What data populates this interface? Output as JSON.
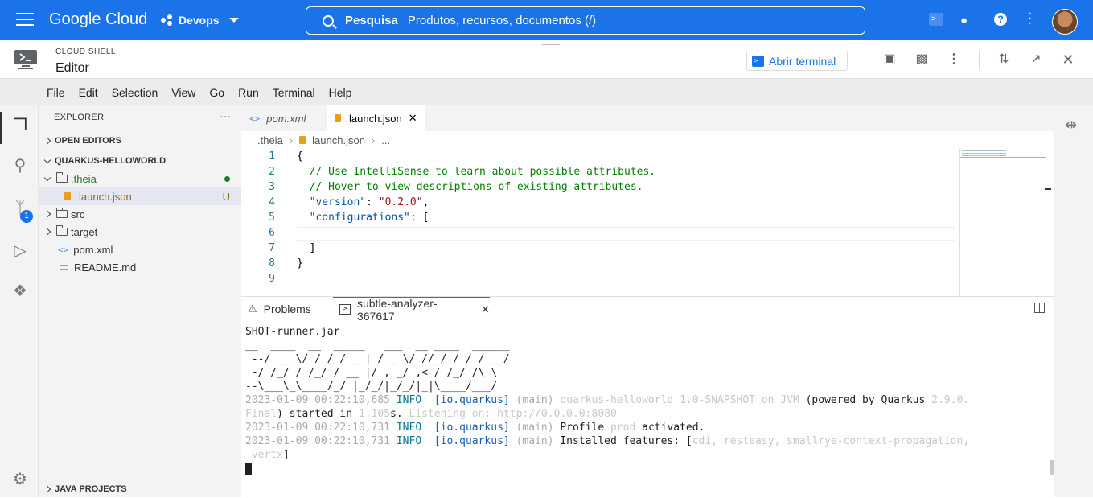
{
  "topbar": {
    "logo": "Google Cloud",
    "project": "Devops",
    "search_label": "Pesquisa",
    "search_placeholder": "Produtos, recursos, documentos (/)"
  },
  "cloudshell": {
    "title": "CLOUD SHELL",
    "subtitle": "Editor",
    "open_terminal": "Abrir terminal"
  },
  "menu": [
    "File",
    "Edit",
    "Selection",
    "View",
    "Go",
    "Run",
    "Terminal",
    "Help"
  ],
  "explorer": {
    "header": "EXPLORER",
    "more": "···",
    "open_editors": "OPEN EDITORS",
    "project": "QUARKUS-HELLOWORLD",
    "items": [
      {
        "name": ".theia"
      },
      {
        "name": "launch.json",
        "status": "U"
      },
      {
        "name": "src"
      },
      {
        "name": "target"
      },
      {
        "name": "pom.xml"
      },
      {
        "name": "README.md"
      }
    ],
    "java_projects": "JAVA PROJECTS"
  },
  "activity": {
    "scm_badge": "1"
  },
  "tabs": [
    {
      "label": "pom.xml"
    },
    {
      "label": "launch.json"
    }
  ],
  "breadcrumb": [
    ".theia",
    "launch.json",
    "..."
  ],
  "editor": {
    "line_numbers": [
      "1",
      "2",
      "3",
      "4",
      "5",
      "6",
      "7",
      "8",
      "9"
    ],
    "lines": {
      "l1": "{",
      "l2": "  // Use IntelliSense to learn about possible attributes.",
      "l3": "  // Hover to view descriptions of existing attributes.",
      "l4_key": "\"version\"",
      "l4_sep": ": ",
      "l4_val": "\"0.2.0\"",
      "l4_end": ",",
      "l5_key": "\"configurations\"",
      "l5_end": ": [",
      "l7": "  ]",
      "l8": "}"
    }
  },
  "panel": {
    "problems": "Problems",
    "terminal_tab": "subtle-analyzer-367617",
    "terminal": {
      "l0": "SHOT-runner.jar",
      "ascii1": "__  ____  __  _____   ___  __ ____  ______ ",
      "ascii2": " --/ __ \\/ / / / _ | / _ \\/ //_/ / / / __/ ",
      "ascii3": " -/ /_/ / /_/ / __ |/ , _/ ,< / /_/ /\\ \\   ",
      "ascii4": "--\\___\\_\\____/_/ |_/_/|_/_/|_|\\____/___/   ",
      "log1_ts": "2023-01-09 00:22:10,685",
      "log1_lvl": "INFO",
      "log1_cat": "[io.quarkus]",
      "log1_thr": "(main)",
      "log1_msg_a": "quarkus-helloworld 1.0-SNAPSHOT on JVM",
      "log1_msg_b": " (powered by Quarkus ",
      "log1_ver": "2.9.0.",
      "log1_cont_a": "Final",
      "log1_cont_b": ") started in ",
      "log1_time": "1.105",
      "log1_cont_c": "s. ",
      "log1_listen": "Listening on: http://0.0.0.0:8080",
      "log2_ts": "2023-01-09 00:22:10,731",
      "log2_lvl": "INFO",
      "log2_cat": "[io.quarkus]",
      "log2_thr": "(main)",
      "log2_msg_a": "Profile ",
      "log2_prof": "prod",
      "log2_msg_b": " activated.",
      "log3_ts": "2023-01-09 00:22:10,731",
      "log3_lvl": "INFO",
      "log3_cat": "[io.quarkus]",
      "log3_thr": "(main)",
      "log3_msg": "Installed features: [",
      "log3_feat": "cdi, resteasy, smallrye-context-propagation,",
      "log3_cont": " vertx",
      "log3_end": "]"
    }
  },
  "colors": {
    "brand": "#1a73e8",
    "string": "#a31515",
    "comment": "#008000",
    "key": "#0451a5"
  }
}
